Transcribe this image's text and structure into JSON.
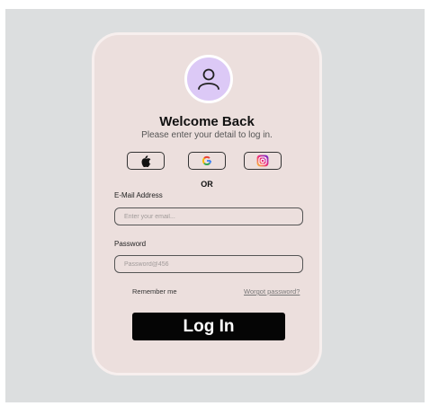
{
  "header": {
    "title": "Welcome Back",
    "subtitle": "Please enter your detail to log in."
  },
  "social": {
    "apple": "apple-icon",
    "google": "google-icon",
    "instagram": "instagram-icon",
    "separator": "OR"
  },
  "form": {
    "email_label": "E-Mail Address",
    "email_placeholder": "Enter your email...",
    "password_label": "Password",
    "password_placeholder": "Password@456",
    "remember_label": "Remember me",
    "forgot_label": "Worgot password?",
    "login_label": "Log In"
  },
  "colors": {
    "card": "#ecdfdd",
    "avatar": "#dcc9f6",
    "button": "#050505",
    "background": "#dcdedf"
  }
}
